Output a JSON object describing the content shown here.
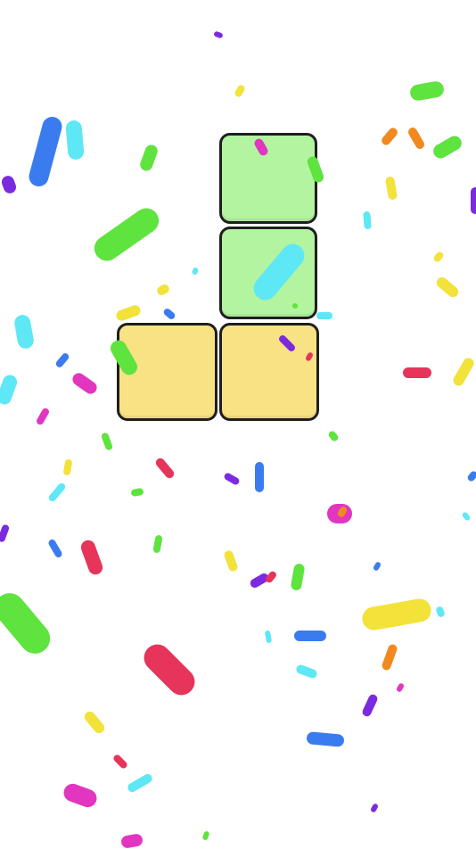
{
  "board": {
    "tiles": [
      {
        "color": "green",
        "hex": "#b2f49f"
      },
      {
        "color": "green",
        "hex": "#b2f49f"
      },
      {
        "color": "yellow",
        "hex": "#f9e284"
      },
      {
        "color": "yellow",
        "hex": "#f9e284"
      }
    ],
    "tile_border_color": "#1f1f1f"
  },
  "confetti": {
    "palette": [
      "#3a7cf0",
      "#5ee33f",
      "#f2e23a",
      "#e6345a",
      "#e235c0",
      "#7a2be0",
      "#5ee7f5",
      "#f08a1e"
    ]
  }
}
